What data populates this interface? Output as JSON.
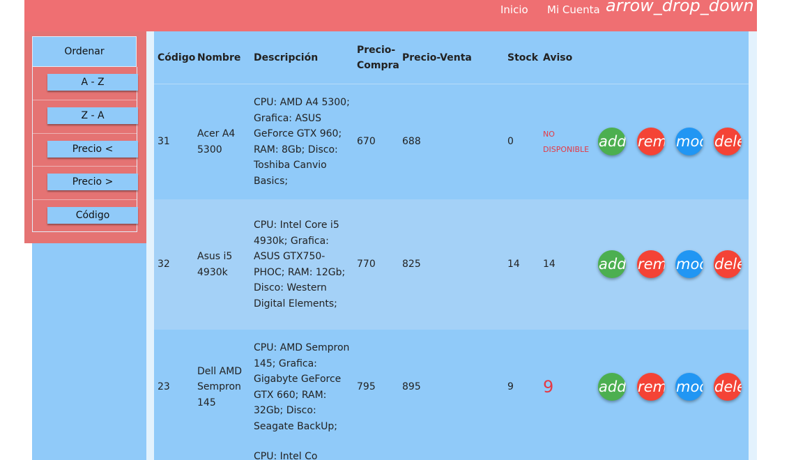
{
  "nav": {
    "inicio": "Inicio",
    "mi_cuenta": "Mi Cuenta",
    "dropdown_icon": "arrow_drop_down"
  },
  "sidebar": {
    "title": "Ordenar",
    "items": [
      {
        "label": "A - Z"
      },
      {
        "label": "Z - A"
      },
      {
        "label": "Precio <"
      },
      {
        "label": "Precio >"
      },
      {
        "label": "Código"
      }
    ]
  },
  "table": {
    "headers": {
      "codigo": "Código",
      "nombre": "Nombre",
      "descripcion": "Descripción",
      "precio_compra": "Precio-Compra",
      "precio_venta": "Precio-Venta",
      "stock": "Stock",
      "aviso": "Aviso"
    },
    "actions": {
      "add": "add",
      "remove": "remove",
      "modify": "mode_edit",
      "delete": "delete"
    },
    "rows": [
      {
        "codigo": "31",
        "nombre": "Acer A4 5300",
        "descripcion": "CPU: AMD A4 5300; Grafica: ASUS GeForce GTX 960; RAM: 8Gb; Disco: Toshiba Canvio Basics;",
        "precio_compra": "670",
        "precio_venta": "688",
        "stock": "0",
        "aviso": "NO DISPONIBLE"
      },
      {
        "codigo": "32",
        "nombre": "Asus i5 4930k",
        "descripcion": "CPU: Intel Core i5 4930k; Grafica: ASUS GTX750-PHOC; RAM: 12Gb; Disco: Western Digital Elements;",
        "precio_compra": "770",
        "precio_venta": "825",
        "stock": "14",
        "aviso": "14"
      },
      {
        "codigo": "23",
        "nombre": "Dell AMD Sempron 145",
        "descripcion": "CPU: AMD Sempron 145; Grafica: Gigabyte GeForce GTX 660; RAM: 32Gb; Disco: Seagate BackUp;",
        "precio_compra": "795",
        "precio_venta": "895",
        "stock": "9",
        "aviso": "9"
      },
      {
        "descripcion": "CPU: Intel Co"
      }
    ]
  },
  "colors": {
    "header": "#ef6f72",
    "sidebar_panel": "#e57373",
    "table_bg": "#90caf9",
    "alt_row": "#a4d1f7",
    "warning": "#e53945",
    "add": "#4caf50",
    "remove": "#f44336",
    "modify": "#2196f3",
    "delete": "#f44336"
  }
}
